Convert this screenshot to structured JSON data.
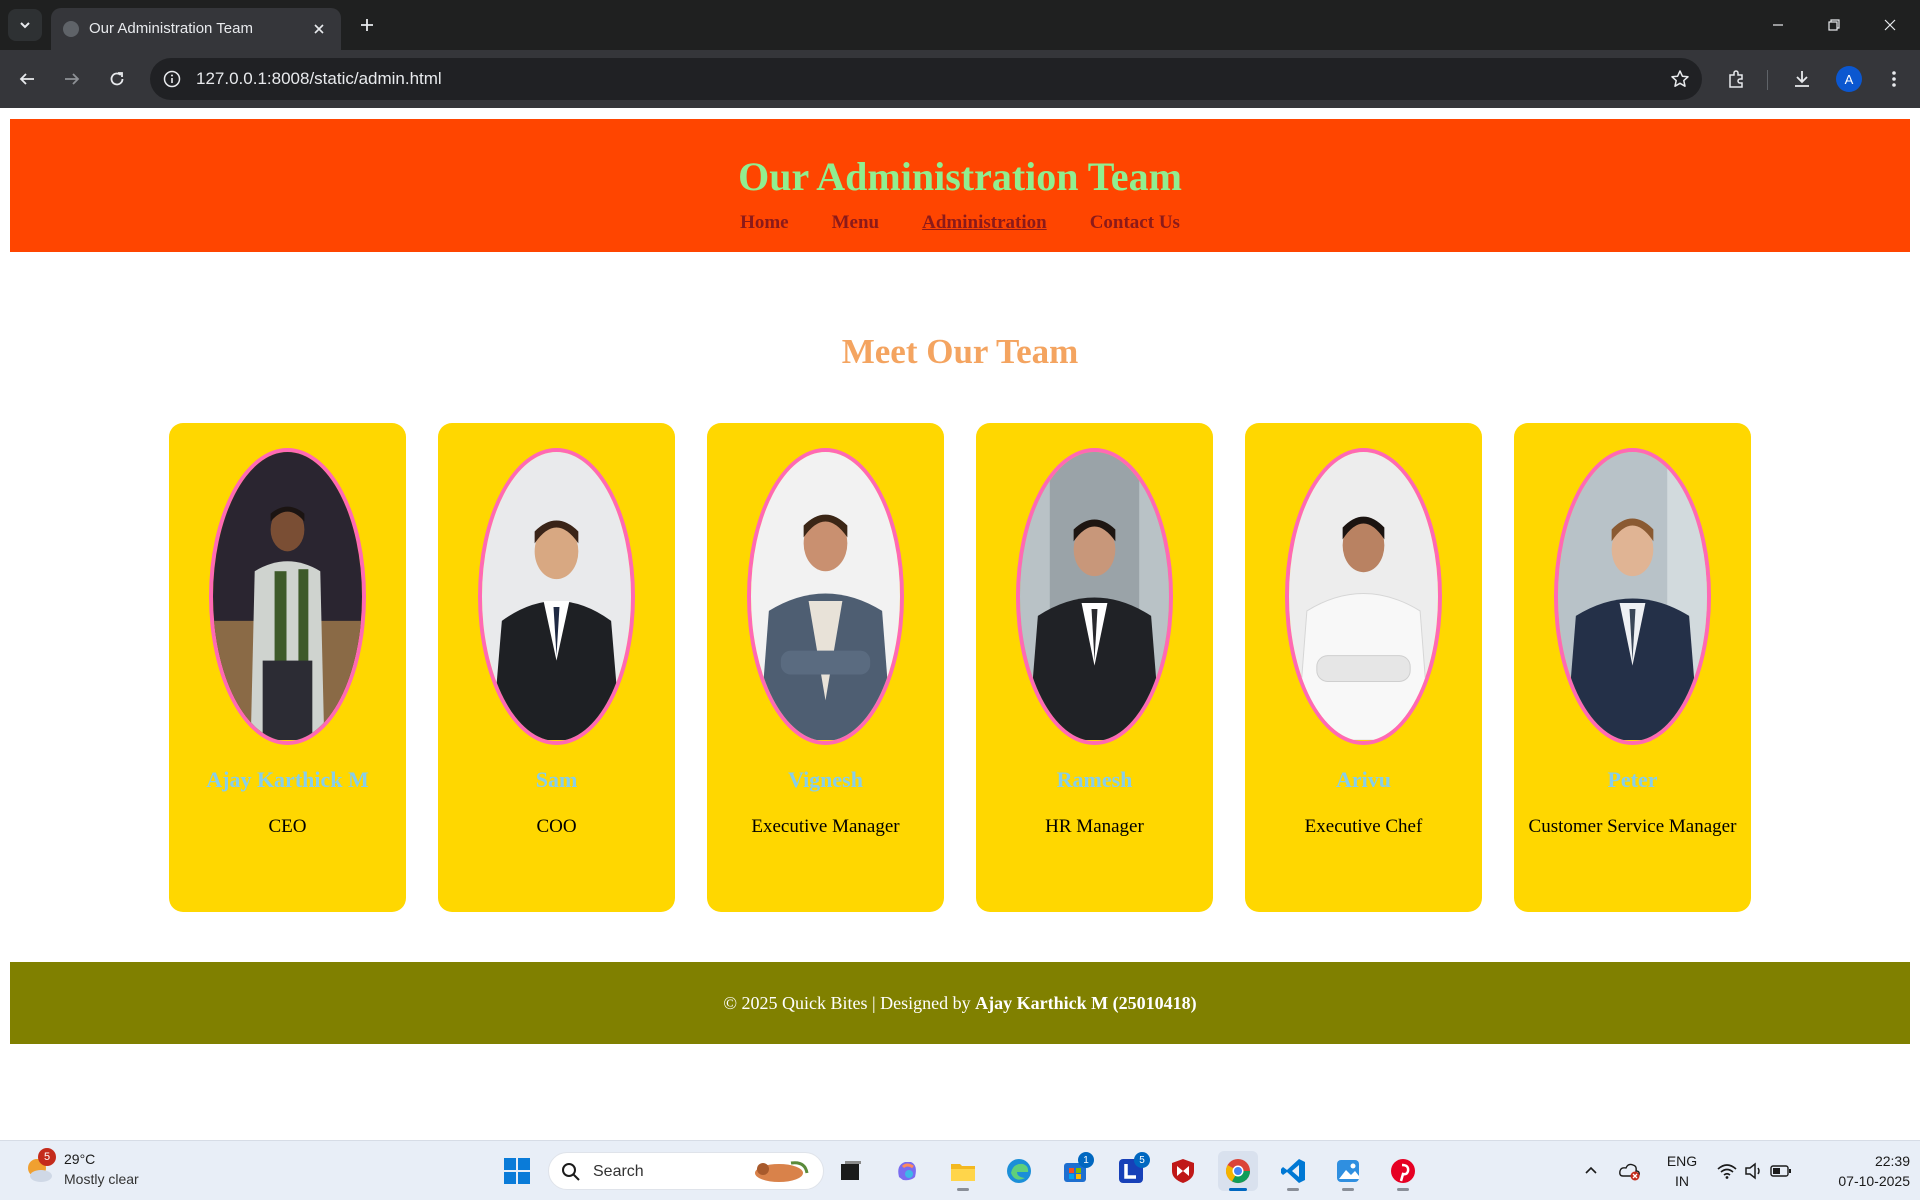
{
  "browser": {
    "tab_title": "Our Administration Team",
    "url": "127.0.0.1:8008/static/admin.html",
    "profile_initial": "A"
  },
  "site": {
    "title": "Our Administration Team",
    "nav": [
      {
        "label": "Home",
        "active": false
      },
      {
        "label": "Menu",
        "active": false
      },
      {
        "label": "Administration",
        "active": true
      },
      {
        "label": "Contact Us",
        "active": false
      }
    ],
    "heading": "Meet Our Team",
    "members": [
      {
        "name": "Ajay Karthick M",
        "role": "CEO"
      },
      {
        "name": "Sam",
        "role": "COO"
      },
      {
        "name": "Vignesh",
        "role": "Executive Manager"
      },
      {
        "name": "Ramesh",
        "role": "HR Manager"
      },
      {
        "name": "Arivu",
        "role": "Executive Chef"
      },
      {
        "name": "Peter",
        "role": "Customer Service Manager"
      }
    ],
    "footer": {
      "prefix": "© 2025 Quick Bites | Designed by ",
      "author": "Ajay Karthick M (25010418)"
    },
    "colors": {
      "header_bg": "#ff4500",
      "title": "#90ee90",
      "nav_link": "#8b1a1a",
      "heading": "#f4a460",
      "card_bg": "#ffd700",
      "photo_border": "#ff69b4",
      "member_name": "#87ceeb",
      "footer_bg": "#808000"
    }
  },
  "taskbar": {
    "weather_badge": "5",
    "weather_temp": "29°C",
    "weather_desc": "Mostly clear",
    "search_placeholder": "Search",
    "store_badge": "1",
    "l_app_badge": "5",
    "lang_1": "ENG",
    "lang_2": "IN",
    "time": "22:39",
    "date": "07-10-2025"
  }
}
